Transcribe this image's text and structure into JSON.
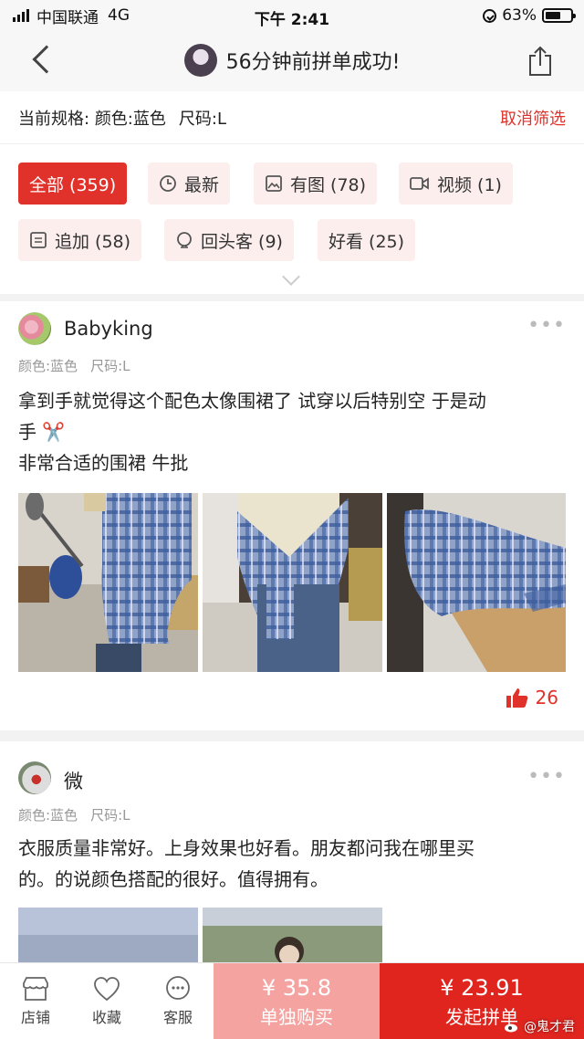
{
  "status_bar": {
    "carrier": "中国联通",
    "network": "4G",
    "time": "下午 2:41",
    "battery_percent": "63%",
    "battery_level": 0.63
  },
  "nav": {
    "title": "56分钟前拼单成功!"
  },
  "spec": {
    "label": "当前规格:",
    "color": "颜色:蓝色",
    "size": "尺码:L",
    "cancel": "取消筛选"
  },
  "filters": [
    {
      "label": "全部 (359)",
      "icon": "none",
      "active": true
    },
    {
      "label": "最新",
      "icon": "clock-icon"
    },
    {
      "label": "有图 (78)",
      "icon": "image-icon"
    },
    {
      "label": "视频 (1)",
      "icon": "video-icon"
    },
    {
      "label": "追加 (58)",
      "icon": "note-icon"
    },
    {
      "label": "回头客 (9)",
      "icon": "return-customer-icon"
    },
    {
      "label": "好看 (25)",
      "icon": "none"
    }
  ],
  "reviews": [
    {
      "user": "Babyking",
      "color": "颜色:蓝色",
      "size": "尺码:L",
      "text_line1": "拿到手就觉得这个配色太像围裙了 试穿以后特别空 于是动",
      "text_line2": "手 ✂️",
      "text_line3": "非常合适的围裙 牛批",
      "likes": "26"
    },
    {
      "user": "微",
      "color": "颜色:蓝色",
      "size": "尺码:L",
      "text_line1": "衣服质量非常好。上身效果也好看。朋友都问我在哪里买",
      "text_line2": "的。的说颜色搭配的很好。值得拥有。"
    }
  ],
  "bottom_bar": {
    "store": "店铺",
    "favorite": "收藏",
    "service": "客服",
    "solo_price": "¥ 35.8",
    "solo_label": "单独购买",
    "group_price": "¥ 23.91",
    "group_label": "发起拼单"
  },
  "watermark": "@鬼才君",
  "colors": {
    "accent": "#e0312a",
    "accent_light": "#fdeeee",
    "solo_button": "#f5a3a0",
    "group_button": "#e0251f"
  }
}
